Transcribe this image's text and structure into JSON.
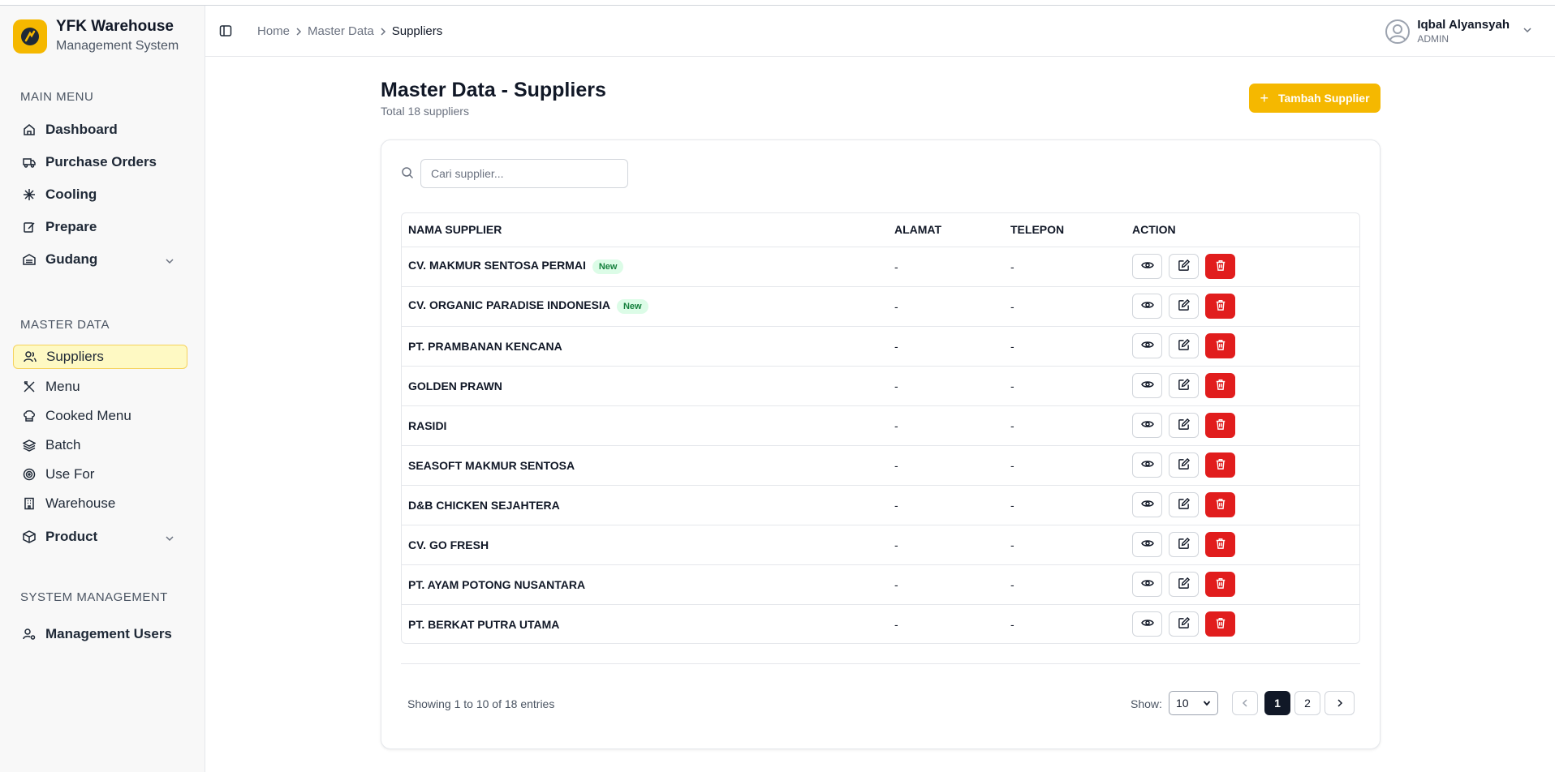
{
  "brand": {
    "title": "YFK Warehouse",
    "subtitle": "Management System"
  },
  "sidebar": {
    "main_menu_label": "MAIN MENU",
    "main_menu": [
      {
        "label": "Dashboard",
        "icon": "home-icon"
      },
      {
        "label": "Purchase Orders",
        "icon": "truck-icon"
      },
      {
        "label": "Cooling",
        "icon": "snowflake-icon"
      },
      {
        "label": "Prepare",
        "icon": "edit-square-icon"
      },
      {
        "label": "Gudang",
        "icon": "warehouse-icon"
      }
    ],
    "master_data_label": "MASTER DATA",
    "master_data": [
      {
        "label": "Suppliers",
        "icon": "users-icon",
        "active": true
      },
      {
        "label": "Menu",
        "icon": "utensils-icon"
      },
      {
        "label": "Cooked Menu",
        "icon": "chef-hat-icon"
      },
      {
        "label": "Batch",
        "icon": "layers-icon"
      },
      {
        "label": "Use For",
        "icon": "target-icon"
      },
      {
        "label": "Warehouse",
        "icon": "building-icon"
      },
      {
        "label": "Product",
        "icon": "package-icon"
      }
    ],
    "system_label": "SYSTEM MANAGEMENT",
    "system": [
      {
        "label": "Management Users",
        "icon": "user-cog-icon"
      }
    ]
  },
  "header": {
    "breadcrumb": [
      "Home",
      "Master Data",
      "Suppliers"
    ],
    "user_name": "Iqbal Alyansyah",
    "user_role": "ADMIN"
  },
  "main": {
    "title": "Master Data - Suppliers",
    "subtitle": "Total 18 suppliers",
    "add_button": "Tambah Supplier",
    "search_placeholder": "Cari supplier...",
    "columns": [
      "NAMA SUPPLIER",
      "ALAMAT",
      "TELEPON",
      "ACTION"
    ],
    "rows": [
      {
        "name": "CV. MAKMUR SENTOSA PERMAI",
        "badge": "New",
        "alamat": "-",
        "telepon": "-"
      },
      {
        "name": "CV. ORGANIC PARADISE INDONESIA",
        "badge": "New",
        "alamat": "-",
        "telepon": "-"
      },
      {
        "name": "PT. PRAMBANAN KENCANA",
        "badge": "",
        "alamat": "-",
        "telepon": "-"
      },
      {
        "name": "GOLDEN PRAWN",
        "badge": "",
        "alamat": "-",
        "telepon": "-"
      },
      {
        "name": "RASIDI",
        "badge": "",
        "alamat": "-",
        "telepon": "-"
      },
      {
        "name": "SEASOFT MAKMUR SENTOSA",
        "badge": "",
        "alamat": "-",
        "telepon": "-"
      },
      {
        "name": "D&B CHICKEN SEJAHTERA",
        "badge": "",
        "alamat": "-",
        "telepon": "-"
      },
      {
        "name": "CV. GO FRESH",
        "badge": "",
        "alamat": "-",
        "telepon": "-"
      },
      {
        "name": "PT. AYAM POTONG NUSANTARA",
        "badge": "",
        "alamat": "-",
        "telepon": "-"
      },
      {
        "name": "PT. BERKAT PUTRA UTAMA",
        "badge": "",
        "alamat": "-",
        "telepon": "-"
      }
    ],
    "pagination": {
      "showing": "Showing 1 to 10 of 18 entries",
      "show_label": "Show:",
      "page_size": "10",
      "pages": [
        "1",
        "2"
      ],
      "current_page": "1"
    }
  },
  "colors": {
    "accent": "#f5b800",
    "danger": "#e11d1d",
    "active_bg": "#fef9c3"
  }
}
